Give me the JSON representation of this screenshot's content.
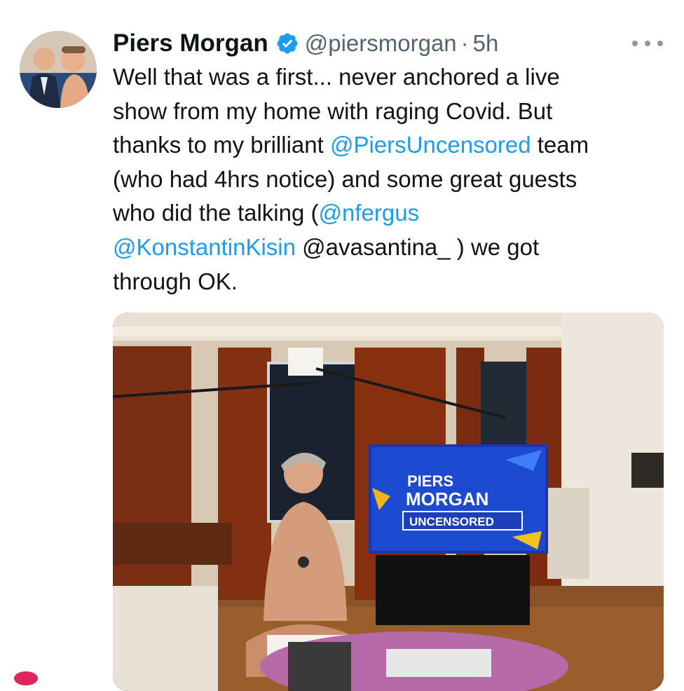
{
  "author": {
    "display_name": "Piers Morgan",
    "handle": "@piersmorgan",
    "separator": "·",
    "time_ago": "5h",
    "verified_icon": "verified-badge-icon",
    "avatar_icon": "avatar-photo"
  },
  "tweet": {
    "lines": [
      [
        {
          "t": "Well that was a first... never anchored a live"
        }
      ],
      [
        {
          "t": "show from my home with raging Covid. But"
        }
      ],
      [
        {
          "t": "thanks to my brilliant "
        },
        {
          "t": "@PiersUncensored",
          "m": true
        },
        {
          "t": " team"
        }
      ],
      [
        {
          "t": "(who had 4hrs notice) and some great guests"
        }
      ],
      [
        {
          "t": "who did the talking ("
        },
        {
          "t": "@nfergus",
          "m": true
        }
      ],
      [
        {
          "t": "@KonstantinKisin",
          "m": true
        },
        {
          "t": " @avasantina_ ) we got"
        }
      ],
      [
        {
          "t": "through OK."
        }
      ]
    ]
  },
  "media": {
    "tv_screen": {
      "line1": "PIERS",
      "line2": "MORGAN",
      "line3": "UNCENSORED"
    }
  },
  "colors": {
    "text": "#0f1419",
    "secondary": "#536471",
    "mention": "#1d9bf0",
    "verified": "#1d9bf0"
  }
}
